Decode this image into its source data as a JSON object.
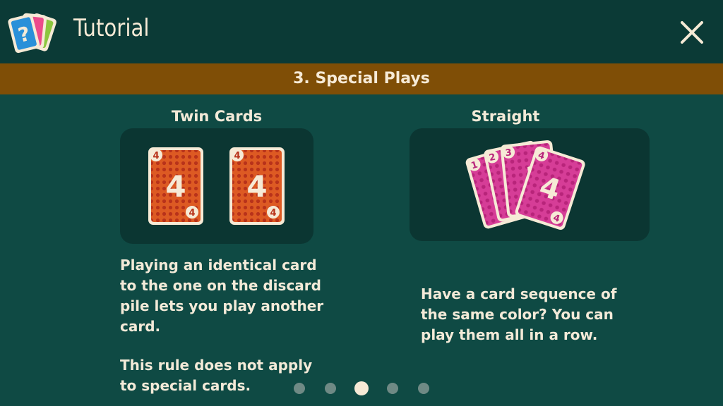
{
  "header": {
    "title": "Tutorial",
    "logo_icon": "question-cards-icon",
    "close_icon": "close-icon"
  },
  "section": {
    "title": "3. Special Plays"
  },
  "left": {
    "title": "Twin Cards",
    "card_value": "4",
    "card_color": "#d9531f",
    "description_1": "Playing an identical card to the one on the discard pile lets you play another card.",
    "description_2": "This rule does not apply to special cards."
  },
  "right": {
    "title": "Straight",
    "card_values": [
      "1",
      "2",
      "3",
      "4"
    ],
    "card_color": "#d63d97",
    "description": "Have a card sequence of the same color? You can play them all in a row."
  },
  "pagination": {
    "total": 5,
    "active_index": 2
  },
  "colors": {
    "background": "#0f4a44",
    "header": "#0b3a36",
    "section_bar": "#7f4e06",
    "panel": "#0b3632",
    "text": "#f3ead8"
  }
}
